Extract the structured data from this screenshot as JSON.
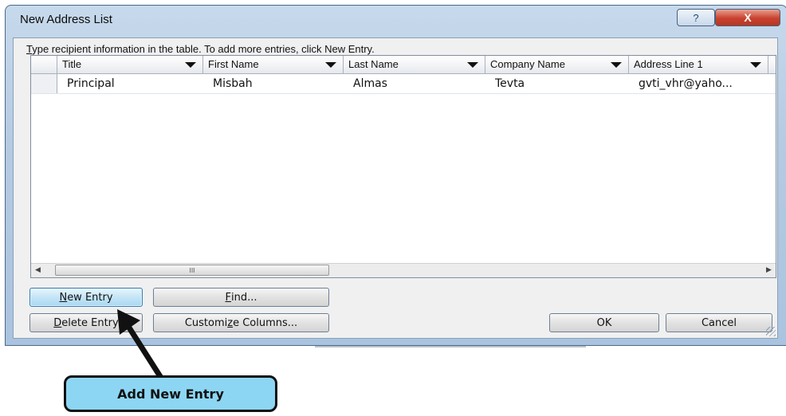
{
  "dialog": {
    "title": "New Address List",
    "help_glyph": "?",
    "close_glyph": "X"
  },
  "instructions": {
    "before": "",
    "mnemonic": "T",
    "after": "ype recipient information in the table.  To add more entries, click New Entry."
  },
  "table": {
    "columns": [
      "Title",
      "First Name",
      "Last Name",
      "Company Name",
      "Address Line 1"
    ],
    "rows": [
      [
        "Principal",
        "Misbah",
        "Almas",
        "Tevta",
        "gvti_vhr@yaho..."
      ]
    ],
    "scroll_glyph": "III"
  },
  "buttons": {
    "new_entry": {
      "mnemonic": "N",
      "rest": "ew Entry"
    },
    "find": {
      "mnemonic": "F",
      "rest": "ind..."
    },
    "delete": {
      "mnemonic": "D",
      "rest": "elete Entry"
    },
    "customize": {
      "pre": "Customi",
      "mnemonic": "z",
      "rest": "e Columns..."
    },
    "ok": "OK",
    "cancel": "Cancel"
  },
  "callout": {
    "label": "Add New Entry"
  },
  "colors": {
    "callout_fill": "#8dd6f3",
    "dialog_frame": "#b5cbe2",
    "close_button": "#c9412f",
    "new_entry_highlight": "#c4e5f6"
  }
}
